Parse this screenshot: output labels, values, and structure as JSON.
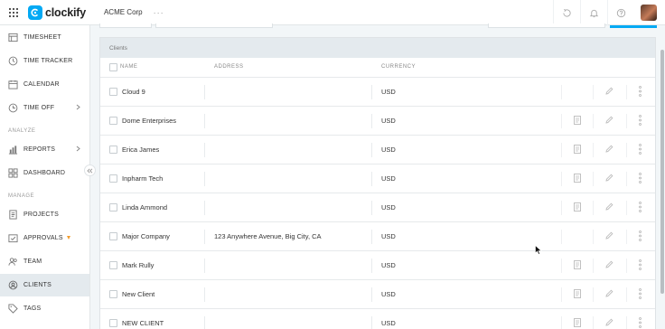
{
  "app": {
    "brand": "clockify",
    "workspace": "ACME Corp",
    "workspace_more": "···"
  },
  "sidebar": {
    "items": [
      {
        "label": "TIMESHEET",
        "icon": "timesheet-icon"
      },
      {
        "label": "TIME TRACKER",
        "icon": "clock-icon"
      },
      {
        "label": "CALENDAR",
        "icon": "calendar-icon"
      },
      {
        "label": "TIME OFF",
        "icon": "time-off-icon"
      },
      {
        "label": "REPORTS",
        "icon": "bar-chart-icon"
      },
      {
        "label": "DASHBOARD",
        "icon": "dashboard-icon"
      },
      {
        "label": "PROJECTS",
        "icon": "projects-icon"
      },
      {
        "label": "APPROVALS",
        "icon": "approvals-icon"
      },
      {
        "label": "TEAM",
        "icon": "team-icon"
      },
      {
        "label": "CLIENTS",
        "icon": "clients-icon"
      },
      {
        "label": "TAGS",
        "icon": "tag-icon"
      }
    ],
    "sections": {
      "analyze": "ANALYZE",
      "manage": "MANAGE"
    },
    "active": "CLIENTS"
  },
  "table": {
    "title": "Clients",
    "columns": {
      "name": "NAME",
      "address": "ADDRESS",
      "currency": "CURRENCY"
    },
    "rows": [
      {
        "name": "Cloud 9",
        "address": "",
        "currency": "USD",
        "has_note": false
      },
      {
        "name": "Dome Enterprises",
        "address": "",
        "currency": "USD",
        "has_note": true
      },
      {
        "name": "Erica James",
        "address": "",
        "currency": "USD",
        "has_note": true
      },
      {
        "name": "Inpharm Tech",
        "address": "",
        "currency": "USD",
        "has_note": true
      },
      {
        "name": "Linda Ammond",
        "address": "",
        "currency": "USD",
        "has_note": true
      },
      {
        "name": "Major Company",
        "address": "123 Anywhere Avenue, Big City, CA",
        "currency": "USD",
        "has_note": false
      },
      {
        "name": "Mark Rully",
        "address": "",
        "currency": "USD",
        "has_note": true
      },
      {
        "name": "New Client",
        "address": "",
        "currency": "USD",
        "has_note": true
      },
      {
        "name": "NEW CLIENT",
        "address": "",
        "currency": "USD",
        "has_note": true
      }
    ]
  },
  "colors": {
    "accent": "#03a9f4",
    "active_bg": "#e4eaee",
    "badge": "#f29c2b"
  }
}
